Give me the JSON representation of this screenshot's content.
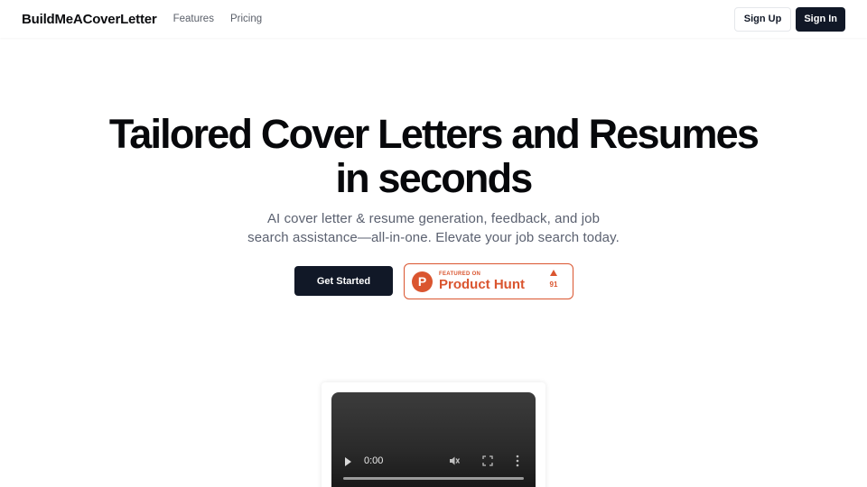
{
  "header": {
    "brand": "BuildMeACoverLetter",
    "nav": [
      "Features",
      "Pricing"
    ],
    "sign_up": "Sign Up",
    "sign_in": "Sign In"
  },
  "hero": {
    "title_line1": "Tailored Cover Letters and Resumes",
    "title_line2": "in seconds",
    "subtitle_line1": "AI cover letter & resume generation, feedback, and job",
    "subtitle_line2": "search assistance—all-in-one. Elevate your job search today.",
    "cta": "Get Started"
  },
  "product_hunt": {
    "logo_letter": "P",
    "featured_label": "FEATURED ON",
    "name": "Product Hunt",
    "votes": "91",
    "color": "#da552f"
  },
  "video": {
    "time": "0:00",
    "icons": [
      "play-icon",
      "mute-icon",
      "fullscreen-icon",
      "more-options-icon"
    ]
  },
  "colors": {
    "primary_dark": "#111827",
    "subtitle_gray": "#5b6170",
    "product_hunt": "#da552f"
  }
}
